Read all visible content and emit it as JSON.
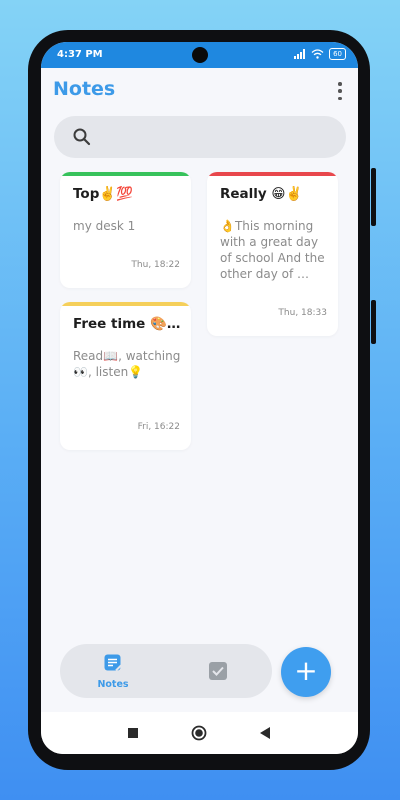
{
  "status_bar": {
    "time": "4:37 PM",
    "battery": "60"
  },
  "app": {
    "title": "Notes"
  },
  "search": {
    "placeholder": ""
  },
  "notes": [
    {
      "title": "Top✌️💯",
      "body": "my desk 1",
      "date": "Thu, 18:22",
      "color": "#37c25b"
    },
    {
      "title": "Really 😁✌️",
      "body": "👌This morning with a great day of school And the other day of …",
      "date": "Thu, 18:33",
      "color": "#e8474c"
    },
    {
      "title": "Free time 🎨🏀…",
      "body": "Read📖, watching👀, listen💡",
      "date": "Fri, 16:22",
      "color": "#f5cf5a"
    }
  ],
  "bottom_nav": {
    "notes_label": "Notes"
  },
  "colors": {
    "accent": "#3d9ae8",
    "status_bar": "#1f88e0",
    "fab": "#3f9eef"
  }
}
